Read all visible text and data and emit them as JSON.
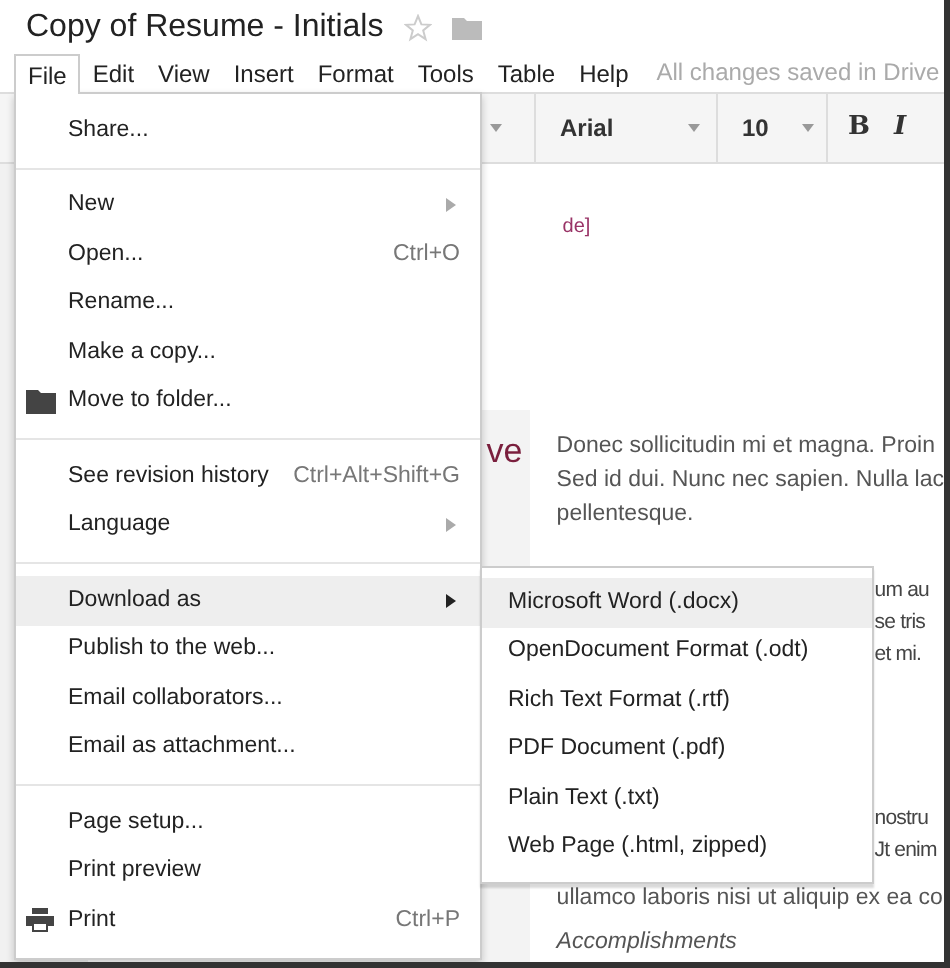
{
  "window": {
    "title": "Copy of Resume - Initials",
    "starred": false
  },
  "menu_bar": [
    {
      "label": "File",
      "selected": true
    },
    {
      "label": "Edit",
      "selected": false
    },
    {
      "label": "View",
      "selected": false
    },
    {
      "label": "Insert",
      "selected": false
    },
    {
      "label": "Format",
      "selected": false
    },
    {
      "label": "Tools",
      "selected": false
    },
    {
      "label": "Table",
      "selected": false
    },
    {
      "label": "Help",
      "selected": false
    }
  ],
  "save_status": "All changes saved in Drive",
  "toolbar": {
    "font": "Arial",
    "size": "10",
    "bold": "B",
    "italic": "I"
  },
  "file_menu": [
    {
      "kind": "item",
      "label": "Share...",
      "selected": false
    },
    {
      "kind": "separator"
    },
    {
      "kind": "item",
      "label": "New",
      "submenu": true,
      "selected": false
    },
    {
      "kind": "item",
      "label": "Open...",
      "shortcut": "Ctrl+O",
      "selected": false
    },
    {
      "kind": "item",
      "label": "Rename...",
      "selected": false
    },
    {
      "kind": "item",
      "label": "Make a copy...",
      "selected": false
    },
    {
      "kind": "folder-item",
      "label": "Move to folder...",
      "selected": false
    },
    {
      "kind": "separator"
    },
    {
      "kind": "item",
      "label": "See revision history",
      "shortcut": "Ctrl+Alt+Shift+G",
      "selected": false
    },
    {
      "kind": "item",
      "label": "Language",
      "submenu": true,
      "selected": false
    },
    {
      "kind": "separator"
    },
    {
      "kind": "item",
      "label": "Download as",
      "submenu": true,
      "selected": true
    },
    {
      "kind": "item",
      "label": "Publish to the web...",
      "selected": false
    },
    {
      "kind": "item",
      "label": "Email collaborators...",
      "selected": false
    },
    {
      "kind": "item",
      "label": "Email as attachment...",
      "selected": false
    },
    {
      "kind": "separator"
    },
    {
      "kind": "item",
      "label": "Page setup...",
      "selected": false
    },
    {
      "kind": "item",
      "label": "Print preview",
      "selected": false
    },
    {
      "kind": "print-item",
      "label": "Print",
      "shortcut": "Ctrl+P",
      "selected": false
    }
  ],
  "download_submenu": [
    {
      "label": "Microsoft Word (.docx)",
      "selected": true
    },
    {
      "label": "OpenDocument Format (.odt)",
      "selected": false
    },
    {
      "label": "Rich Text Format (.rtf)",
      "selected": false
    },
    {
      "label": "PDF Document (.pdf)",
      "selected": false
    },
    {
      "label": "Plain Text (.txt)",
      "selected": false
    },
    {
      "label": "Web Page (.html, zipped)",
      "selected": false
    }
  ],
  "document": {
    "header_fragment": "de]",
    "heading_fragment": "ve",
    "paragraph": [
      "Donec sollicitudin mi et magna. Proin",
      "Sed id dui. Nunc nec sapien. Nulla lac",
      "pellentesque."
    ],
    "fragments_1": [
      "um au",
      "se tris",
      "et mi."
    ],
    "fragments_2": [
      "nostru",
      "Jt enim"
    ],
    "line": "ullamco laboris nisi ut aliquip ex ea co",
    "subheading": "Accomplishments"
  }
}
